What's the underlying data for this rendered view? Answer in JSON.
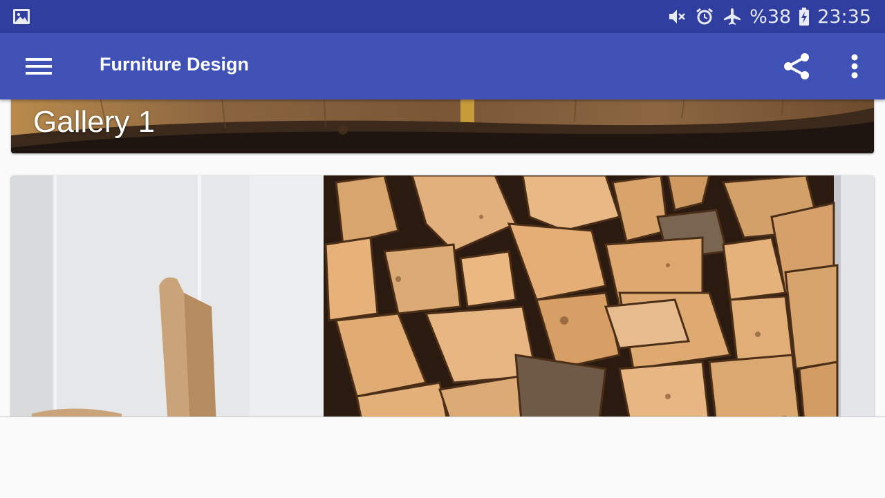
{
  "status_bar": {
    "left_icon": "gallery-icon",
    "icons": [
      "mute-icon",
      "alarm-icon",
      "airplane-icon"
    ],
    "battery_text": "%38",
    "battery_icon": "battery-charging-icon",
    "time": "23:35"
  },
  "app_bar": {
    "menu_icon": "hamburger-menu-icon",
    "title": "Furniture Design",
    "share_icon": "share-icon",
    "more_icon": "more-vertical-icon",
    "color": "#3f51b5",
    "status_color": "#303f9f"
  },
  "gallery": {
    "cards": [
      {
        "title": "Gallery 1",
        "image": "wood-table-image"
      },
      {
        "title": "",
        "image": "firewood-stack-image"
      }
    ]
  }
}
